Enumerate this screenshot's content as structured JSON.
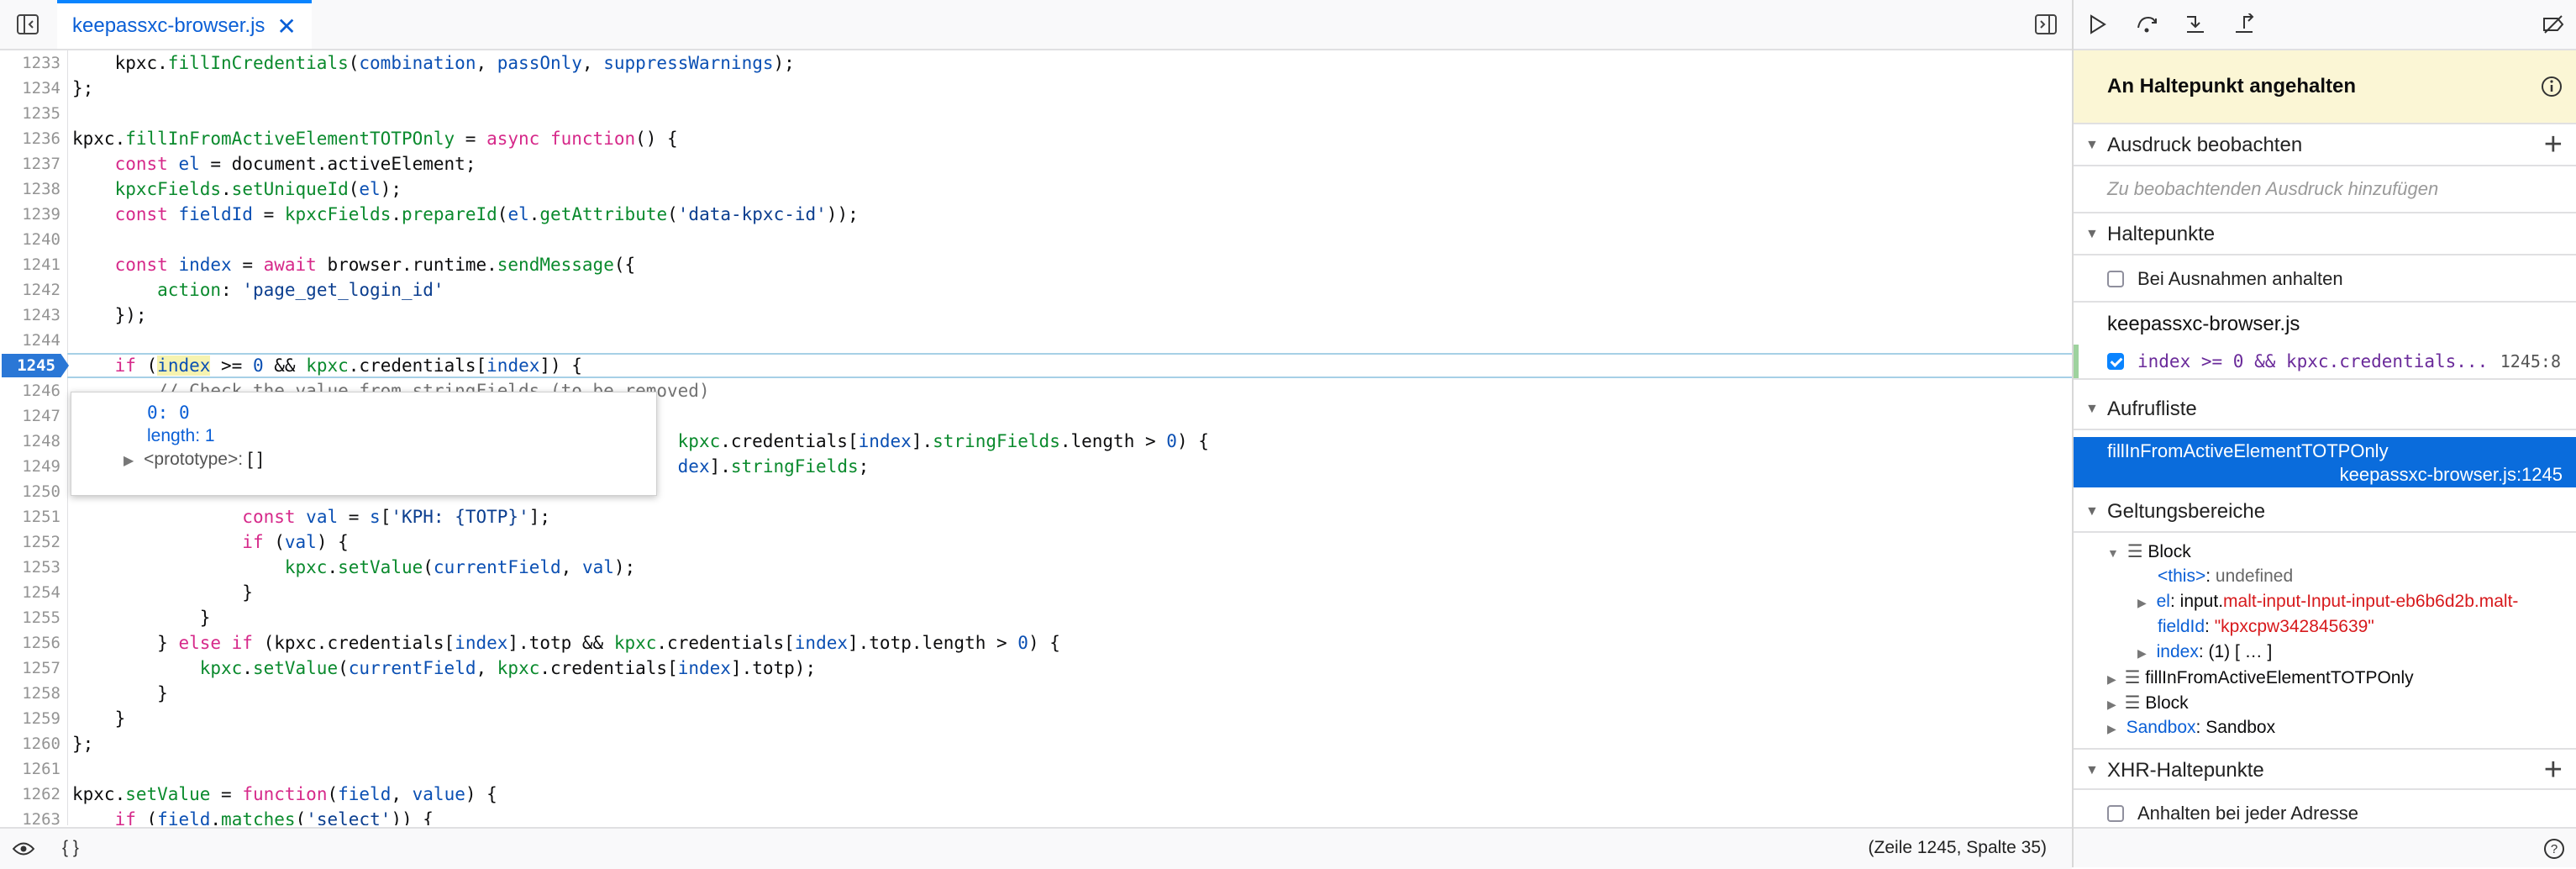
{
  "editor": {
    "tab_label": "keepassxc-browser.js",
    "breakpoint_line": "1245",
    "lines": [
      {
        "n": "1233",
        "html": "    kpxc.<span class='fn'>fillInCredentials</span>(<span class='prop'>combination</span>, <span class='prop'>passOnly</span>, <span class='prop'>suppressWarnings</span>);"
      },
      {
        "n": "1234",
        "html": "};"
      },
      {
        "n": "1235",
        "html": ""
      },
      {
        "n": "1236",
        "html": "kpxc.<span class='fn'>fillInFromActiveElementTOTPOnly</span> = <span class='kw'>async</span> <span class='kw'>function</span>() {"
      },
      {
        "n": "1237",
        "html": "    <span class='kw'>const</span> <span class='prop'>el</span> = document.activeElement;"
      },
      {
        "n": "1238",
        "html": "    <span class='fn'>kpxcFields</span>.<span class='fn'>setUniqueId</span>(<span class='prop'>el</span>);"
      },
      {
        "n": "1239",
        "html": "    <span class='kw'>const</span> <span class='prop'>fieldId</span> = <span class='fn'>kpxcFields</span>.<span class='fn'>prepareId</span>(<span class='prop'>el</span>.<span class='fn'>getAttribute</span>(<span class='str'>'data-kpxc-id'</span>));"
      },
      {
        "n": "1240",
        "html": ""
      },
      {
        "n": "1241",
        "html": "    <span class='kw'>const</span> <span class='prop'>index</span> = <span class='kw'>await</span> browser.runtime.<span class='fn'>sendMessage</span>({"
      },
      {
        "n": "1242",
        "html": "        <span class='fn'>action</span>: <span class='str'>'page_get_login_id'</span>"
      },
      {
        "n": "1243",
        "html": "    });"
      },
      {
        "n": "1244",
        "html": ""
      },
      {
        "n": "1245",
        "html": "    <span class='kw'>if</span> (<span class='prop hi'>index</span> >= <span class='num'>0</span> && <span class='fn'>kpxc</span>.credentials[<span class='prop'>index</span>]) {"
      },
      {
        "n": "1246",
        "html": "        <span class='cmt'>// Check the value from stringFields (to be removed)</span>"
      },
      {
        "n": "1247",
        "html": ""
      },
      {
        "n": "1248",
        "html": "                                                         <span class='fn'>kpxc</span>.credentials[<span class='prop'>index</span>].<span class='fn'>stringFields</span>.length > <span class='num'>0</span>) {"
      },
      {
        "n": "1249",
        "html": "                                                         <span class='prop'>dex</span>].<span class='fn'>stringFields</span>;"
      },
      {
        "n": "1250",
        "html": ""
      },
      {
        "n": "1251",
        "html": "                <span class='kw'>const</span> <span class='prop'>val</span> = <span class='prop'>s</span>[<span class='str'>'KPH: {TOTP}'</span>];"
      },
      {
        "n": "1252",
        "html": "                <span class='kw'>if</span> (<span class='prop'>val</span>) {"
      },
      {
        "n": "1253",
        "html": "                    <span class='fn'>kpxc</span>.<span class='fn'>setValue</span>(<span class='prop'>currentField</span>, <span class='prop'>val</span>);"
      },
      {
        "n": "1254",
        "html": "                }"
      },
      {
        "n": "1255",
        "html": "            }"
      },
      {
        "n": "1256",
        "html": "        } <span class='kw'>else if</span> (kpxc.credentials[<span class='prop'>index</span>].totp && <span class='fn'>kpxc</span>.credentials[<span class='prop'>index</span>].totp.length > <span class='num'>0</span>) {"
      },
      {
        "n": "1257",
        "html": "            <span class='fn'>kpxc</span>.<span class='fn'>setValue</span>(<span class='prop'>currentField</span>, <span class='fn'>kpxc</span>.credentials[<span class='prop'>index</span>].totp);"
      },
      {
        "n": "1258",
        "html": "        }"
      },
      {
        "n": "1259",
        "html": "    }"
      },
      {
        "n": "1260",
        "html": "};"
      },
      {
        "n": "1261",
        "html": ""
      },
      {
        "n": "1262",
        "html": "kpxc.<span class='fn'>setValue</span> = <span class='kw'>function</span>(<span class='prop'>field</span>, <span class='prop'>value</span>) {"
      },
      {
        "n": "1263",
        "html": "    <span class='kw'>if</span> (<span class='prop'>field</span>.<span class='fn'>matches</span>(<span class='str'>'select'</span>)) {"
      }
    ],
    "tooltip": {
      "line1_key": "0",
      "line1_val": "0",
      "line2_key": "length",
      "line2_val": "1",
      "line3_key": "<prototype>",
      "line3_val": "[ ]"
    },
    "status": {
      "braces": "{ }",
      "position": "(Zeile 1245, Spalte 35)"
    }
  },
  "sidebar": {
    "paused_text": "An Haltepunkt angehalten",
    "watch": {
      "title": "Ausdruck beobachten",
      "placeholder": "Zu beobachtenden Ausdruck hinzufügen"
    },
    "breakpoints": {
      "title": "Haltepunkte",
      "pause_on_exceptions": "Bei Ausnahmen anhalten",
      "file": "keepassxc-browser.js",
      "entry_text": "index >= 0 && kpxc.credentials...",
      "entry_loc": "1245:8"
    },
    "callstack": {
      "title": "Aufrufliste",
      "frame_name": "fillInFromActiveElementTOTPOnly",
      "frame_loc": "keepassxc-browser.js:1245"
    },
    "scopes": {
      "title": "Geltungsbereiche",
      "block": "Block",
      "this_key": "<this>",
      "this_val": "undefined",
      "el_key": "el",
      "el_val_prefix": "input.",
      "el_val": "malt-input-Input-input-eb6b6d2b.malt-",
      "fieldid_key": "fieldId",
      "fieldid_val": "\"kpxcpw342845639\"",
      "index_key": "index",
      "index_val": "(1) [ … ]",
      "fn_scope": "fillInFromActiveElementTOTPOnly",
      "block2": "Block",
      "sandbox_key": "Sandbox",
      "sandbox_val": "Sandbox"
    },
    "xhr": {
      "title": "XHR-Haltepunkte",
      "any_url": "Anhalten bei jeder Adresse"
    }
  },
  "colors": {
    "accent": "#0a84ff",
    "breakpoint": "#2a77d6",
    "paused_bg": "#fbf6d5",
    "selected_frame": "#0a6cdc"
  }
}
